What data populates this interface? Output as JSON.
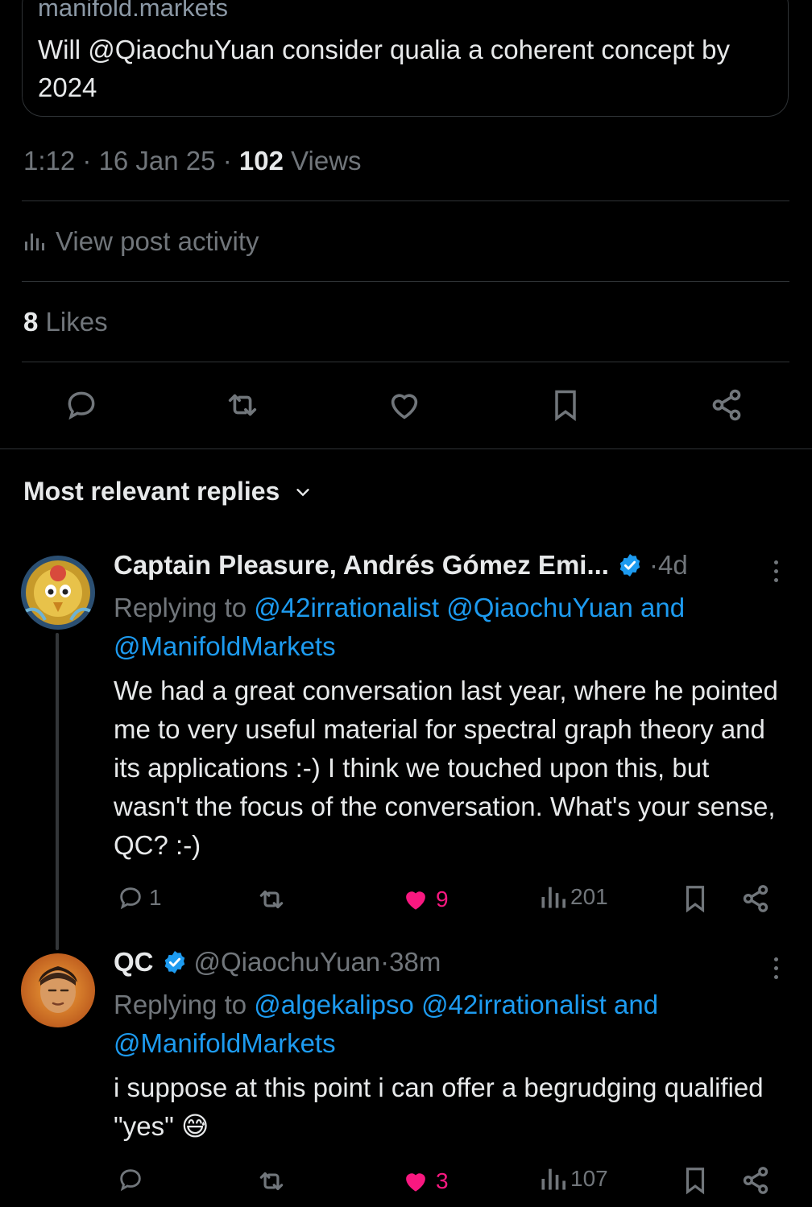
{
  "quoted_card": {
    "domain": "manifold.markets",
    "title": "Will @QiaochuYuan consider qualia a coherent concept by 2024"
  },
  "post_meta": {
    "time": "1:12",
    "sep1": " · ",
    "date": "16 Jan 25",
    "sep2": " · ",
    "views_count": "102",
    "views_label": " Views"
  },
  "activity": {
    "label": "View post activity",
    "icon": "analytics-icon"
  },
  "likes": {
    "count": "8",
    "label": " Likes"
  },
  "actions": {
    "reply_icon": "reply-icon",
    "retweet_icon": "retweet-icon",
    "like_icon": "heart-icon",
    "bookmark_icon": "bookmark-icon",
    "share_icon": "share-icon"
  },
  "replies_section": {
    "title": "Most relevant replies"
  },
  "colors": {
    "accent": "#1d9bf0",
    "like": "#f91880",
    "muted": "#71767b",
    "text": "#e7e9ea",
    "border": "#2f3336",
    "background": "#000000"
  },
  "replies": [
    {
      "name": "Captain Pleasure, Andrés Gómez Emi...",
      "dot": " · ",
      "time": "4d",
      "replying_prefix": "Replying to ",
      "mentions": [
        "@42irrationalist",
        "@QiaochuYuan",
        "and",
        "@ManifoldMarkets"
      ],
      "text": "We had a great conversation last year, where he pointed me to very useful material for spectral graph theory and its applications :-)  I think we touched upon this, but wasn't the focus of the conversation. What's your sense, QC? :-)",
      "reply_count": "1",
      "retweet_count": "",
      "like_count": "9",
      "view_count": "201"
    },
    {
      "name": "QC",
      "handle": "@QiaochuYuan",
      "dot": " · ",
      "time": "38m",
      "replying_prefix": "Replying to ",
      "mentions": [
        "@algekalipso",
        "@42irrationalist",
        "and",
        "@ManifoldMarkets"
      ],
      "text": "i suppose at this point i can offer a begrudging qualified \"yes\" 😅",
      "reply_count": "",
      "retweet_count": "",
      "like_count": "3",
      "view_count": "107"
    }
  ]
}
